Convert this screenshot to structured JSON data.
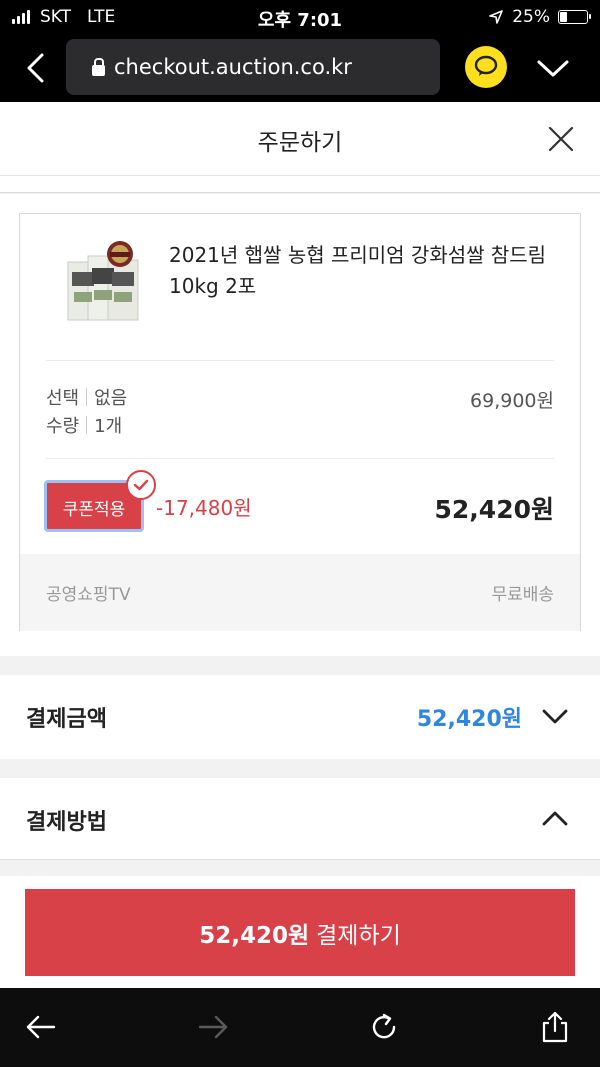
{
  "status_bar": {
    "carrier": "SKT",
    "network": "LTE",
    "time": "오후 7:01",
    "battery": "25%",
    "battery_level": 0.25
  },
  "browser": {
    "url": "checkout.auction.co.kr"
  },
  "page": {
    "title": "주문하기"
  },
  "order": {
    "product_name": "2021년 햅쌀 농협 프리미엄 강화섬쌀 참드림 10kg 2포",
    "option_label": "선택",
    "option_value": "없음",
    "quantity_label": "수량",
    "quantity_value": "1개",
    "option_price": "69,900원",
    "coupon_label": "쿠폰적용",
    "discount": "-17,480원",
    "final_price": "52,420원",
    "seller": "공영쇼핑TV",
    "shipping": "무료배송"
  },
  "payment_amount": {
    "label": "결제금액",
    "value": "52,420원"
  },
  "payment_method": {
    "label": "결제방법"
  },
  "pay_button": {
    "amount": "52,420원",
    "label": "결제하기"
  },
  "colors": {
    "accent_red": "#d94148",
    "accent_blue": "#2f86e0",
    "talk_yellow": "#ffdf1e"
  }
}
